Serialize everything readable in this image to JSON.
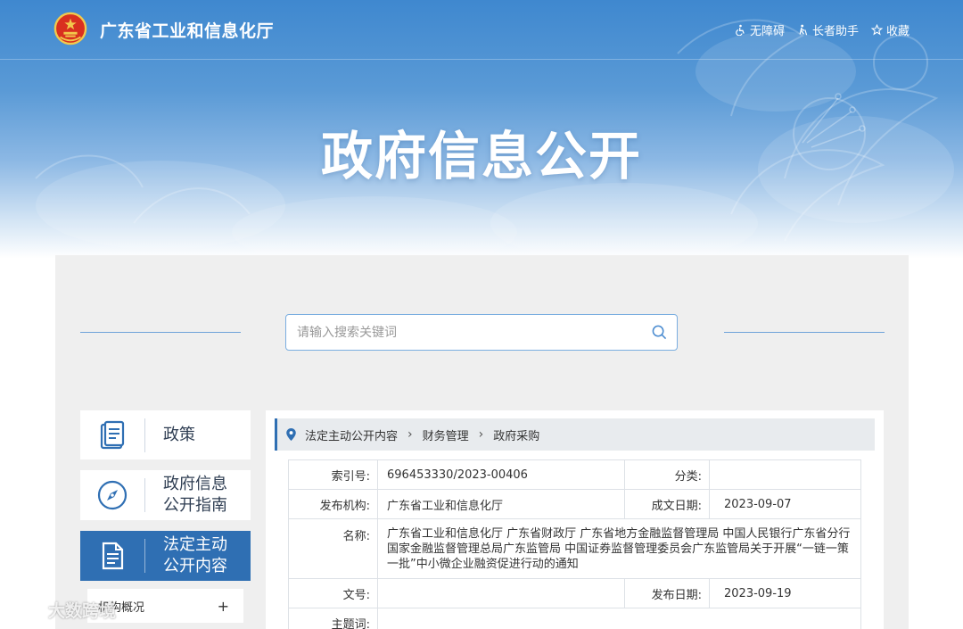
{
  "header": {
    "site_title": "广东省工业和信息化厅",
    "tools": [
      {
        "label": "无障碍",
        "icon": "accessibility-icon"
      },
      {
        "label": "长者助手",
        "icon": "elder-helper-icon"
      },
      {
        "label": "收藏",
        "icon": "star-icon"
      }
    ]
  },
  "hero": {
    "title": "政府信息公开"
  },
  "search": {
    "placeholder": "请输入搜索关键词"
  },
  "sidebar": {
    "items": [
      {
        "label_line1": "政策",
        "label_line2": "",
        "icon": "document-book-icon",
        "active": false
      },
      {
        "label_line1": "政府信息",
        "label_line2": "公开指南",
        "icon": "compass-icon",
        "active": false
      },
      {
        "label_line1": "法定主动",
        "label_line2": "公开内容",
        "icon": "document-list-icon",
        "active": true
      }
    ],
    "sub_item": {
      "label": "机构概况",
      "expand": "+"
    }
  },
  "breadcrumb": [
    "法定主动公开内容",
    "财务管理",
    "政府采购"
  ],
  "info": {
    "index_label": "索引号:",
    "index_value": "696453330/2023-00406",
    "category_label": "分类:",
    "category_value": "",
    "publisher_label": "发布机构:",
    "publisher_value": "广东省工业和信息化厅",
    "created_label": "成文日期:",
    "created_value": "2023-09-07",
    "name_label": "名称:",
    "name_value": "广东省工业和信息化厅 广东省财政厅 广东省地方金融监督管理局 中国人民银行广东省分行 国家金融监督管理总局广东监管局 中国证券监督管理委员会广东监管局关于开展“一链一策一批”中小微企业融资促进行动的通知",
    "docno_label": "文号:",
    "docno_value": "",
    "published_label": "发布日期:",
    "published_value": "2023-09-19",
    "subject_label": "主题词:",
    "subject_value": ""
  },
  "watermark": {
    "text": "大数跨境"
  },
  "colors": {
    "primary": "#2f6fb3",
    "banner": "#3f88cf",
    "panel_bg": "#efefef"
  }
}
